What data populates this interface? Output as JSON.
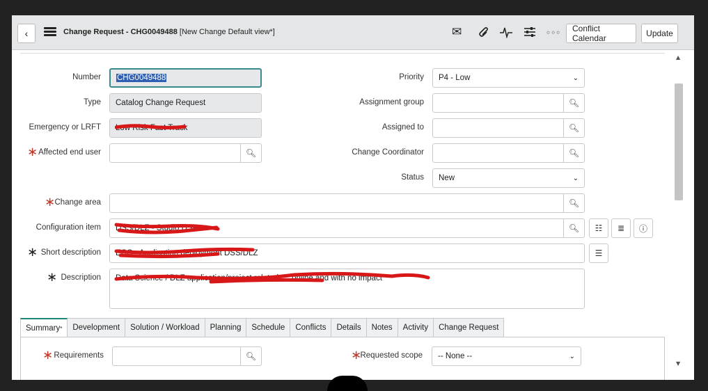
{
  "header": {
    "title": "Change Request - CHG0049488",
    "view": "[New Change Default view*]",
    "buttons": {
      "conflict_calendar": "Conflict Calendar",
      "update": "Update"
    },
    "icons": [
      "mail-icon",
      "paperclip-icon",
      "activity-icon",
      "settings-sliders-icon",
      "more-icon"
    ]
  },
  "form": {
    "number": {
      "label": "Number",
      "value": "CHG0049488"
    },
    "type": {
      "label": "Type",
      "value": "Catalog Change Request"
    },
    "emergency": {
      "label": "Emergency or LRFT",
      "value": "Low Risk Fast Track"
    },
    "affected_end_user": {
      "label": "Affected end user",
      "value": ""
    },
    "priority": {
      "label": "Priority",
      "value": "P4 - Low"
    },
    "assignment_group": {
      "label": "Assignment group",
      "value": ""
    },
    "assigned_to": {
      "label": "Assigned to",
      "value": ""
    },
    "change_coordinator": {
      "label": "Change Coordinator",
      "value": ""
    },
    "status": {
      "label": "Status",
      "value": "New"
    },
    "change_area": {
      "label": "Change area",
      "value": ""
    },
    "configuration_item": {
      "label": "Configuration item",
      "value": "DSS/DLZ - Studio DSP"
    },
    "short_description": {
      "label": "Short description",
      "value": "ECC - Application deployment DSS/DLZ"
    },
    "description": {
      "label": "Description",
      "value": "Data Science / DLZ application/project related, ... online and with no impact"
    }
  },
  "tabs": [
    {
      "label": "Summary",
      "active": true,
      "mark": "*"
    },
    {
      "label": "Development"
    },
    {
      "label": "Solution / Workload"
    },
    {
      "label": "Planning"
    },
    {
      "label": "Schedule"
    },
    {
      "label": "Conflicts"
    },
    {
      "label": "Details"
    },
    {
      "label": "Notes"
    },
    {
      "label": "Activity"
    },
    {
      "label": "Change Request"
    }
  ],
  "summary": {
    "requirements": {
      "label": "Requirements",
      "value": ""
    },
    "requested_scope": {
      "label": "Requested scope",
      "value": "-- None --"
    }
  },
  "colors": {
    "required": "#c0392b",
    "active_tab": "#1f8476",
    "selection": "#2f5fb3",
    "redaction": "#d81818"
  }
}
